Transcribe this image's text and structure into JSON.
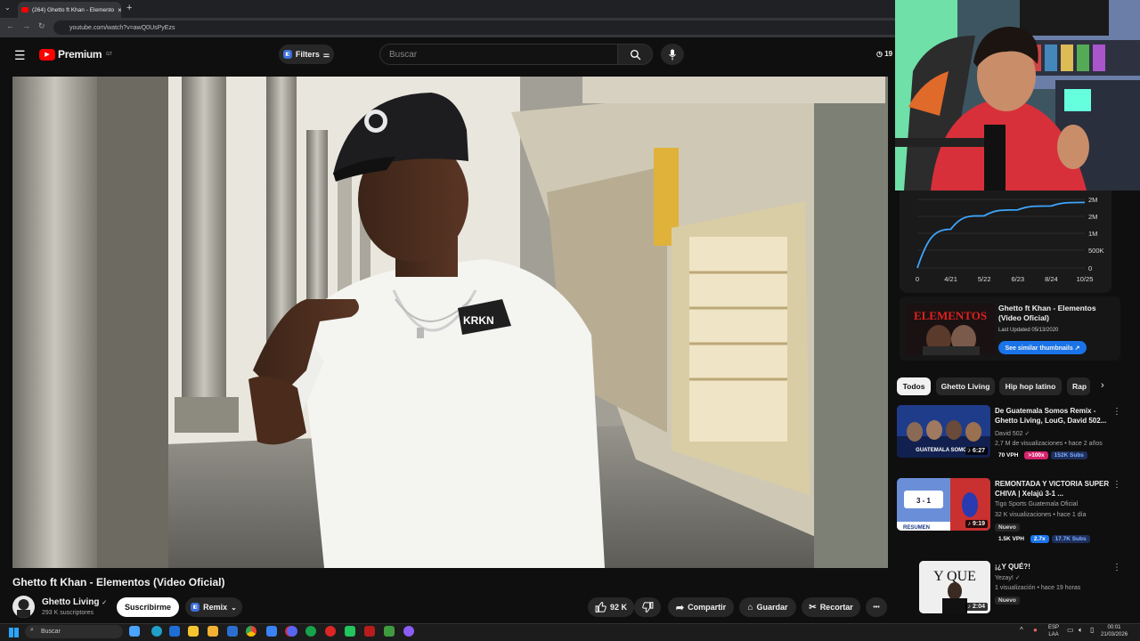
{
  "browser": {
    "tab_title": "(264) Ghetto ft Khan - Elemento",
    "url": "youtube.com/watch?v=awQ0UsPyEzs",
    "new_tab": "+",
    "close_tab": "×"
  },
  "header": {
    "logo_text": "Premium",
    "logo_sup": "GT",
    "filters_label": "Filters",
    "search_placeholder": "Buscar",
    "clock_fragment": "19"
  },
  "video": {
    "title": "Ghetto ft Khan - Elementos (Video Oficial)",
    "shirt_logo": "KRKN",
    "cap_badge": "◎"
  },
  "channel": {
    "name": "Ghetto Living",
    "subscribers": "293 K suscriptores",
    "subscribe_label": "Suscribirme",
    "remix_label": "Remix"
  },
  "actions": {
    "likes": "92 K",
    "share": "Compartir",
    "save": "Guardar",
    "clip": "Recortar",
    "more": "•••"
  },
  "stats_widget": {
    "y_ticks": [
      "2M",
      "2M",
      "1M",
      "500K",
      "0"
    ],
    "x_ticks": [
      "0",
      "4/21",
      "5/22",
      "6/23",
      "8/24",
      "10/25"
    ],
    "thumb_title": "Ghetto ft Khan - Elementos (Video Oficial)",
    "last_updated": "Last Updated 05/13/2020",
    "similar_button": "See similar thumbnails ↗",
    "thumb_text": "ELEMENTOS"
  },
  "chart_data": {
    "type": "line",
    "x": [
      "0",
      "4/21",
      "5/22",
      "6/23",
      "8/24",
      "10/25"
    ],
    "series": [
      {
        "values": [
          0,
          1300000,
          1750000,
          1950000,
          2080000,
          2200000
        ]
      }
    ],
    "y_tick_labels": [
      "0",
      "500K",
      "1M",
      "2M",
      "2M"
    ],
    "grid": true
  },
  "chips": [
    "Todos",
    "Ghetto Living",
    "Hip hop latino",
    "Rap"
  ],
  "recommendations": [
    {
      "title": "De Guatemala Somos Remix - Ghetto Living, LouG, David 502...",
      "channel": "David 502",
      "stats": "2,7 M de visualizaciones • hace 2 años",
      "duration": "6:27",
      "badges": [
        "70 VPH",
        ">100x",
        "152K Subs"
      ],
      "thumb_text": "GUATEMALA SOMOS"
    },
    {
      "title": "REMONTADA Y VICTORIA SUPER CHIVA | Xelajú 3-1 ...",
      "channel": "Tigo Sports Guatemala Oficial",
      "stats": "32 K visualizaciones • hace 1 día",
      "new_label": "Nuevo",
      "duration": "9:19",
      "badges": [
        "1.5K VPH",
        "2.7x",
        "17.7K Subs"
      ],
      "thumb_text": "RESUMEN",
      "score": "3 - 1"
    },
    {
      "title": "¡¿Y QUÉ?!",
      "channel": "Yezay!",
      "stats": "1 visualización • hace 19 horas",
      "new_label": "Nuevo",
      "duration": "2:04",
      "thumb_text": "Y QUE"
    }
  ],
  "taskbar": {
    "search_placeholder": "Buscar",
    "lang_top": "ESP",
    "lang_bottom": "LAA",
    "time": "00:01",
    "date": "21/03/2026"
  },
  "colors": {
    "yt_red": "#ff0000",
    "chart_line": "#3ea6ff",
    "subscribe_bg": "#ffffff",
    "similar_btn": "#1a73e8"
  }
}
